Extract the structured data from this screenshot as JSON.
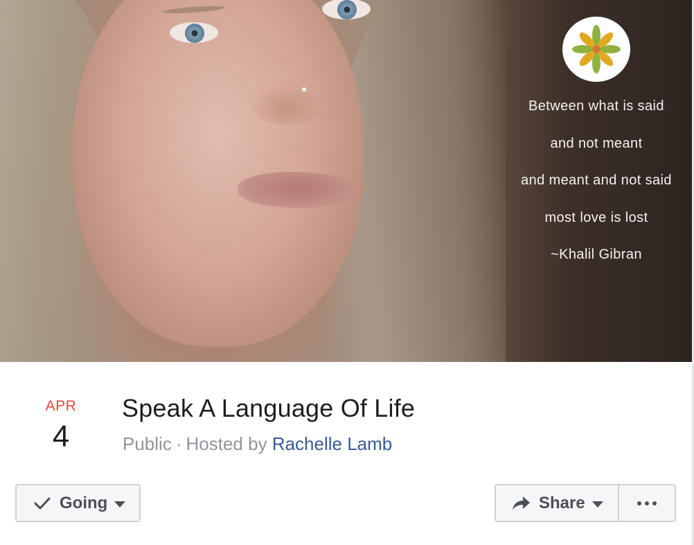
{
  "cover": {
    "quote_lines": [
      "Between what is said",
      "and not meant",
      "and meant and not said",
      "most love is lost",
      "~Khalil Gibran"
    ],
    "logo_icon": "mandala-logo-icon"
  },
  "event": {
    "month": "APR",
    "day": "4",
    "title": "Speak A Language Of Life",
    "privacy": "Public",
    "separator": "·",
    "hosted_by_prefix": "Hosted by",
    "host": "Rachelle Lamb"
  },
  "actions": {
    "going_label": "Going",
    "share_label": "Share",
    "icons": [
      "check-icon",
      "caret-down-icon",
      "share-arrow-icon",
      "more-dots-icon"
    ]
  },
  "colors": {
    "date_month": "#e9453a",
    "host_link": "#385898",
    "meta_text": "#90949c",
    "button_bg": "#f5f6f7",
    "button_border": "#ced0d4"
  }
}
